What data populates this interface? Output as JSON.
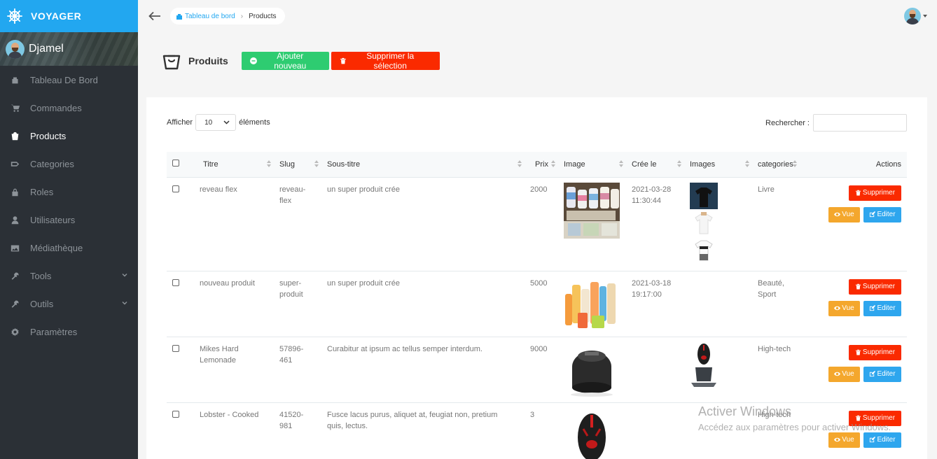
{
  "brand": {
    "name": "VOYAGER"
  },
  "user": {
    "name": "Djamel"
  },
  "sidebar": {
    "items": [
      {
        "label": "Tableau De Bord",
        "icon": "dashboard-icon"
      },
      {
        "label": "Commandes",
        "icon": "cart-icon"
      },
      {
        "label": "Products",
        "icon": "bag-icon",
        "active": true
      },
      {
        "label": "Categories",
        "icon": "tag-icon"
      },
      {
        "label": "Roles",
        "icon": "lock-icon"
      },
      {
        "label": "Utilisateurs",
        "icon": "person-icon"
      },
      {
        "label": "Médiathèque",
        "icon": "image-icon"
      },
      {
        "label": "Tools",
        "icon": "tools-icon",
        "has_children": true
      },
      {
        "label": "Outils",
        "icon": "tools-icon",
        "has_children": true
      },
      {
        "label": "Paramètres",
        "icon": "gear-icon"
      }
    ]
  },
  "breadcrumb": {
    "home": "Tableau de bord",
    "current": "Products"
  },
  "page": {
    "title": "Produits",
    "add_label": "Ajouter nouveau",
    "delete_selection_label": "Supprimer la sélection"
  },
  "table_controls": {
    "show_prefix": "Afficher",
    "show_value": "10",
    "show_suffix": "éléments",
    "search_label": "Rechercher :"
  },
  "columns": [
    "Titre",
    "Slug",
    "Sous-titre",
    "Prix",
    "Image",
    "Cree le",
    "Images",
    "categories",
    "Actions"
  ],
  "column_labels": {
    "titre": "Titre",
    "slug": "Slug",
    "sous_titre": "Sous-titre",
    "prix": "Prix",
    "image": "Image",
    "cree": "Crée le",
    "images": "Images",
    "categories": "categories",
    "actions": "Actions"
  },
  "rows": [
    {
      "titre": "reveau flex",
      "slug": "reveau-\nflex",
      "sous_titre": "un super produit crée",
      "prix": "2000",
      "cree": "2021-03-28\n11:30:44",
      "categories": "Livre"
    },
    {
      "titre": "nouveau produit",
      "slug": "super-\nproduit",
      "sous_titre": "un super produit crée",
      "prix": "5000",
      "cree": "2021-03-18\n19:17:00",
      "categories": "Beauté,\nSport"
    },
    {
      "titre": "Mikes Hard\nLemonade",
      "slug": "57896-\n461",
      "sous_titre": "Curabitur at ipsum ac tellus semper interdum.",
      "prix": "9000",
      "cree": "",
      "categories": "High-tech"
    },
    {
      "titre": "Lobster - Cooked",
      "slug": "41520-\n981",
      "sous_titre": "Fusce lacus purus, aliquet at, feugiat non, pretium\nquis, lectus.",
      "prix": "3",
      "cree": "",
      "categories": "High-tech"
    }
  ],
  "actions": {
    "delete": "Supprimer",
    "view": "Vue",
    "edit": "Editer"
  },
  "watermark": {
    "line1": "Activer Windows",
    "line2": "Accédez aux paramètres pour activer Windows."
  },
  "colors": {
    "brand": "#22a7f0",
    "sidebar": "#2b3036",
    "green": "#2ecc71",
    "red": "#fa2a00",
    "orange": "#f4a72d",
    "blue": "#2ea6ee"
  }
}
